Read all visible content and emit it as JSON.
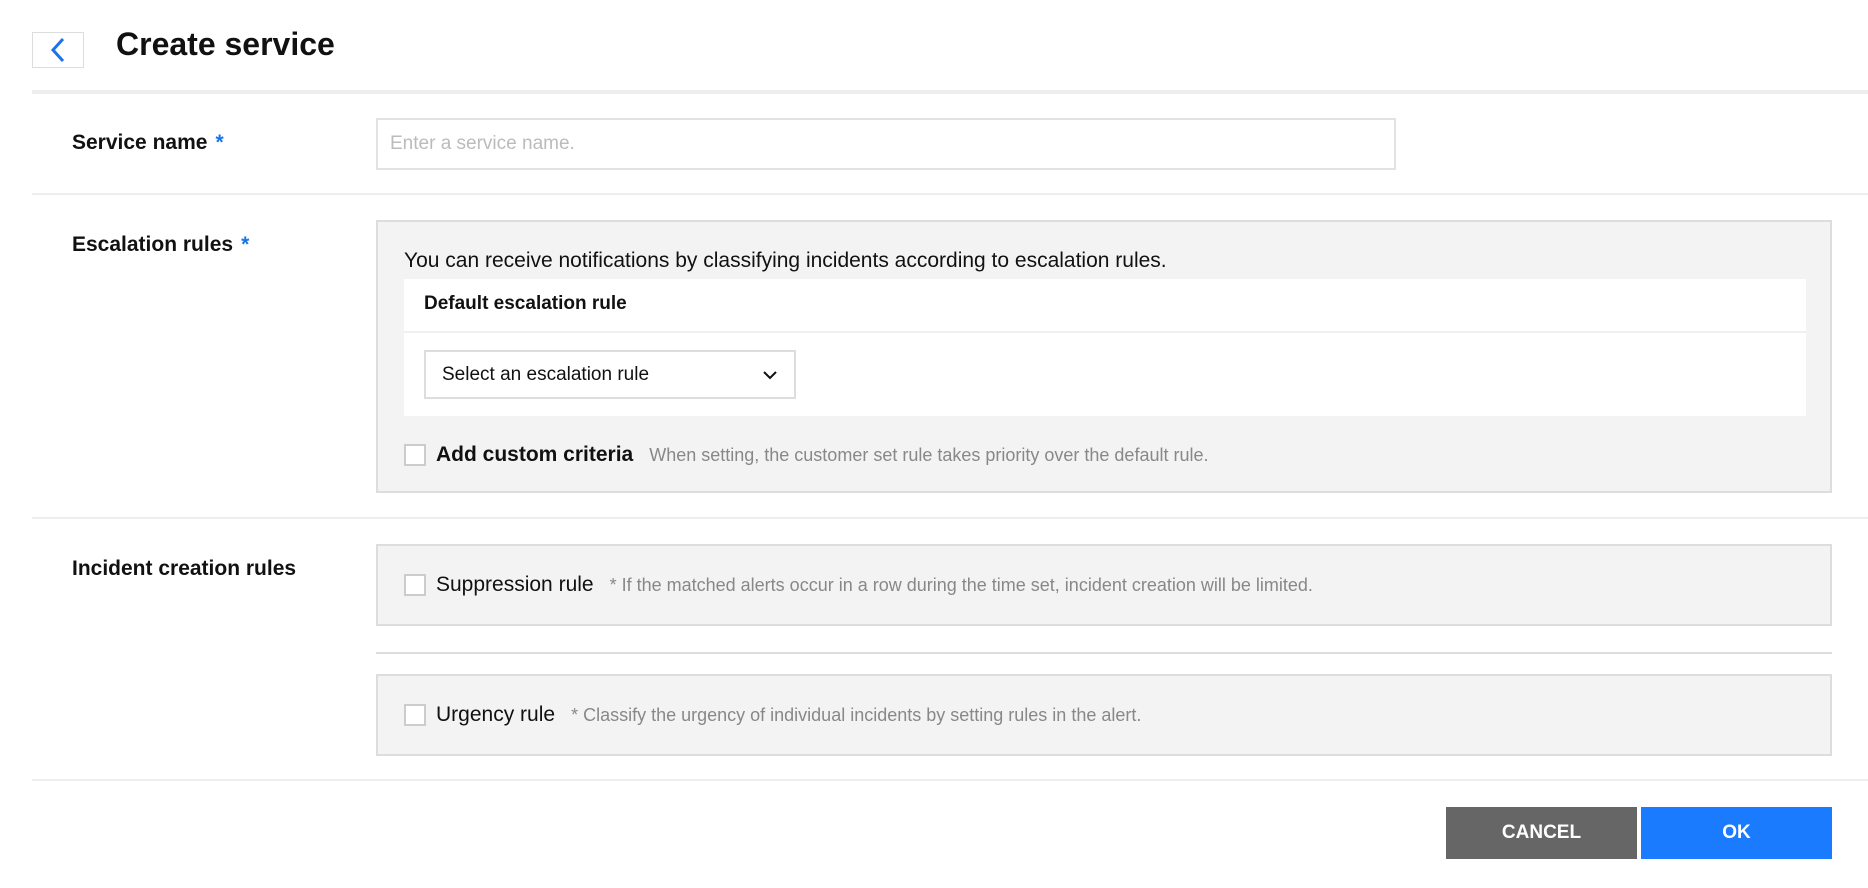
{
  "header": {
    "title": "Create service",
    "back_icon": "chevron-left-icon"
  },
  "service_name": {
    "label": "Service name",
    "required": "*",
    "placeholder": "Enter a service name.",
    "value": ""
  },
  "escalation": {
    "label": "Escalation rules",
    "required": "*",
    "description": "You can receive notifications by classifying incidents according to escalation rules.",
    "default_rule_heading": "Default escalation rule",
    "select_value": "Select an escalation rule",
    "custom_label": "Add custom criteria",
    "custom_hint": "When setting, the customer set rule takes priority over the default rule."
  },
  "incident": {
    "label": "Incident creation rules",
    "suppression_label": "Suppression rule",
    "suppression_hint": "* If the matched alerts occur in a row during the time set, incident creation will be limited.",
    "urgency_label": "Urgency rule",
    "urgency_hint": "* Classify the urgency of individual incidents by setting rules in the alert."
  },
  "buttons": {
    "cancel": "CANCEL",
    "ok": "OK"
  },
  "colors": {
    "accent": "#1a73e8",
    "ok": "#1a7bff",
    "cancel": "#666666"
  }
}
